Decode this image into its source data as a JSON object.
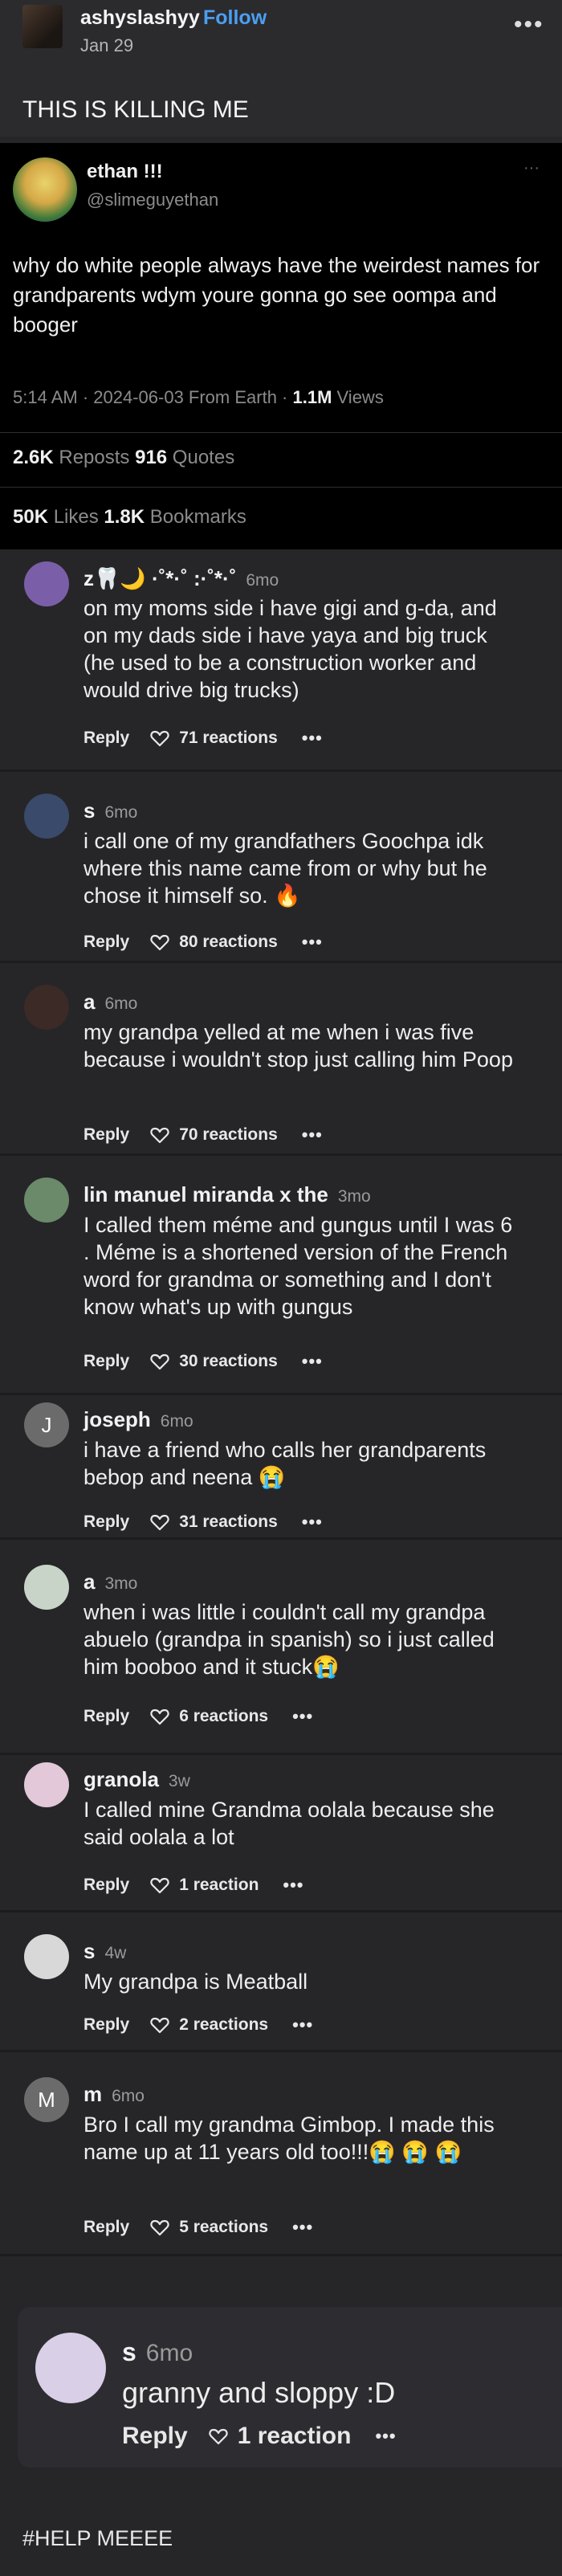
{
  "post": {
    "author": "ashyslashyy",
    "follow_label": "Follow",
    "date": "Jan 29",
    "text": "THIS IS KILLING ME",
    "more_label": "•••"
  },
  "tweet": {
    "name": "ethan !!!",
    "handle": "@slimeguyethan",
    "more_label": "···",
    "body": "why do white people always have the weirdest names for grandparents wdym youre gonna go see oompa and booger",
    "meta_prefix": "5:14 AM · 2024-06-03 From Earth · ",
    "views_count": "1.1M",
    "views_label": " Views",
    "reposts_count": "2.6K",
    "reposts_label": " Reposts ",
    "quotes_count": "916",
    "quotes_label": " Quotes",
    "likes_count": "50K",
    "likes_label": " Likes ",
    "bookmarks_count": "1.8K",
    "bookmarks_label": " Bookmarks"
  },
  "reply_label": "Reply",
  "comments": [
    {
      "name": "z🦷🌙 ·˚*·˚ :·˚*·˚",
      "time": "6mo",
      "text": "on my moms side i have gigi and g-da, and on my dads side i have yaya and big truck (he used to be a construction worker and would drive big trucks)",
      "reactions": "71 reactions",
      "avatar_initial": "",
      "avatar_color": "#7a5fa8"
    },
    {
      "name": "s",
      "time": "6mo",
      "text": "i call one of my grandfathers Goochpa idk where this name came from or why but he chose it himself so. 🔥",
      "reactions": "80 reactions",
      "avatar_initial": "",
      "avatar_color": "#3a4a6a"
    },
    {
      "name": "a",
      "time": "6mo",
      "text": "my grandpa yelled at me when i was five because i wouldn't stop just calling him Poop",
      "reactions": "70 reactions",
      "avatar_initial": "",
      "avatar_color": "#3b2a25"
    },
    {
      "name": "lin manuel miranda x the",
      "time": "3mo",
      "text": "I called them méme and gungus until I was 6 . Méme is a shortened version of the French word for grandma or something and I don't know what's up with gungus",
      "reactions": "30 reactions",
      "avatar_initial": "",
      "avatar_color": "#6a8a6a"
    },
    {
      "name": "joseph",
      "time": "6mo",
      "text": "i have a friend who calls her grandparents bebop and neena 😭",
      "reactions": "31 reactions",
      "avatar_initial": "J",
      "avatar_color": "#6b6b6b"
    },
    {
      "name": "a",
      "time": "3mo",
      "text": "when i was little i couldn't call my grandpa abuelo (grandpa in spanish) so i just called him booboo and it stuck😭",
      "reactions": "6 reactions",
      "avatar_initial": "",
      "avatar_color": "#c9d4c9"
    },
    {
      "name": "granola",
      "time": "3w",
      "text": "I called mine Grandma oolala because she said oolala a lot",
      "reactions": "1 reaction",
      "avatar_initial": "",
      "avatar_color": "#e2c8d8"
    },
    {
      "name": "s",
      "time": "4w",
      "text": "My grandpa is Meatball",
      "reactions": "2 reactions",
      "avatar_initial": "",
      "avatar_color": "#d8d8d8"
    },
    {
      "name": "m",
      "time": "6mo",
      "text": "Bro I call my grandma Gimbop. I made this name up at 11 years old too!!!😭 😭 😭",
      "reactions": "5 reactions",
      "avatar_initial": "M",
      "avatar_color": "#6b6b6b"
    },
    {
      "name": "s",
      "time": "6mo",
      "text": "granny and sloppy :D",
      "reactions": "1 reaction",
      "avatar_initial": "",
      "avatar_color": "#d9cfe6"
    }
  ],
  "more_label": "•••",
  "footer_text": "#HELP MEEEE"
}
